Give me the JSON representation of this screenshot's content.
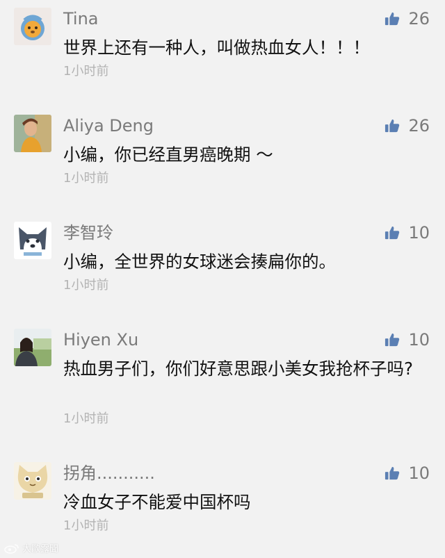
{
  "colors": {
    "background": "#f2f2f2",
    "name": "#7a7a7a",
    "content": "#111111",
    "time": "#b3b3b3",
    "like_icon": "#5b7fb3"
  },
  "comments": [
    {
      "name": "Tina",
      "likes": "26",
      "content": "世界上还有一种人，叫做热血女人！！！",
      "time": "1小时前",
      "avatar_icon": "cartoon-lion-avatar-icon"
    },
    {
      "name": "Aliya Deng",
      "likes": "26",
      "content": "小编，你已经直男癌晚期 ～",
      "time": "1小时前",
      "avatar_icon": "woman-photo-avatar-icon"
    },
    {
      "name": "李智玲",
      "likes": "10",
      "content": "小编，全世界的女球迷会揍扁你的。",
      "time": "1小时前",
      "avatar_icon": "husky-dog-avatar-icon"
    },
    {
      "name": "Hiyen Xu",
      "likes": "10",
      "content": "热血男子们，你们好意思跟小美女我抢杯子吗?",
      "time": "1小时前",
      "avatar_icon": "woman-outdoor-avatar-icon"
    },
    {
      "name": "拐角...........",
      "likes": "10",
      "content": "冷血女子不能爱中国杯吗",
      "time": "1小时前",
      "avatar_icon": "cartoon-cat-avatar-icon"
    }
  ],
  "like_icon": "thumbs-up-icon",
  "watermark": {
    "text": "大歐露聞"
  }
}
